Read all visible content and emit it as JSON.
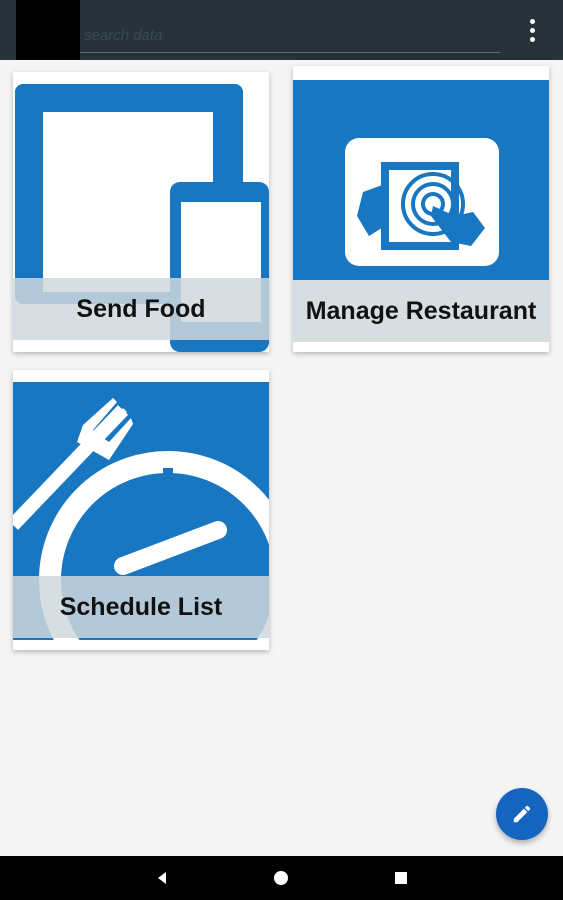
{
  "search": {
    "placeholder": "search data",
    "value": ""
  },
  "tiles": [
    {
      "label": "Send Food",
      "icon": "devices-icon"
    },
    {
      "label": "Manage Restaurant",
      "icon": "touch-tablet-icon"
    },
    {
      "label": "Schedule List",
      "icon": "fork-clock-icon"
    }
  ],
  "fab": {
    "icon": "pencil-icon"
  },
  "navbar": {
    "icons": [
      "back-icon",
      "home-icon",
      "recents-icon"
    ]
  },
  "colors": {
    "appbar": "#263238",
    "tile_blue": "#1976c0",
    "fab": "#1565c0",
    "label_overlay": "#cfd8dc"
  }
}
